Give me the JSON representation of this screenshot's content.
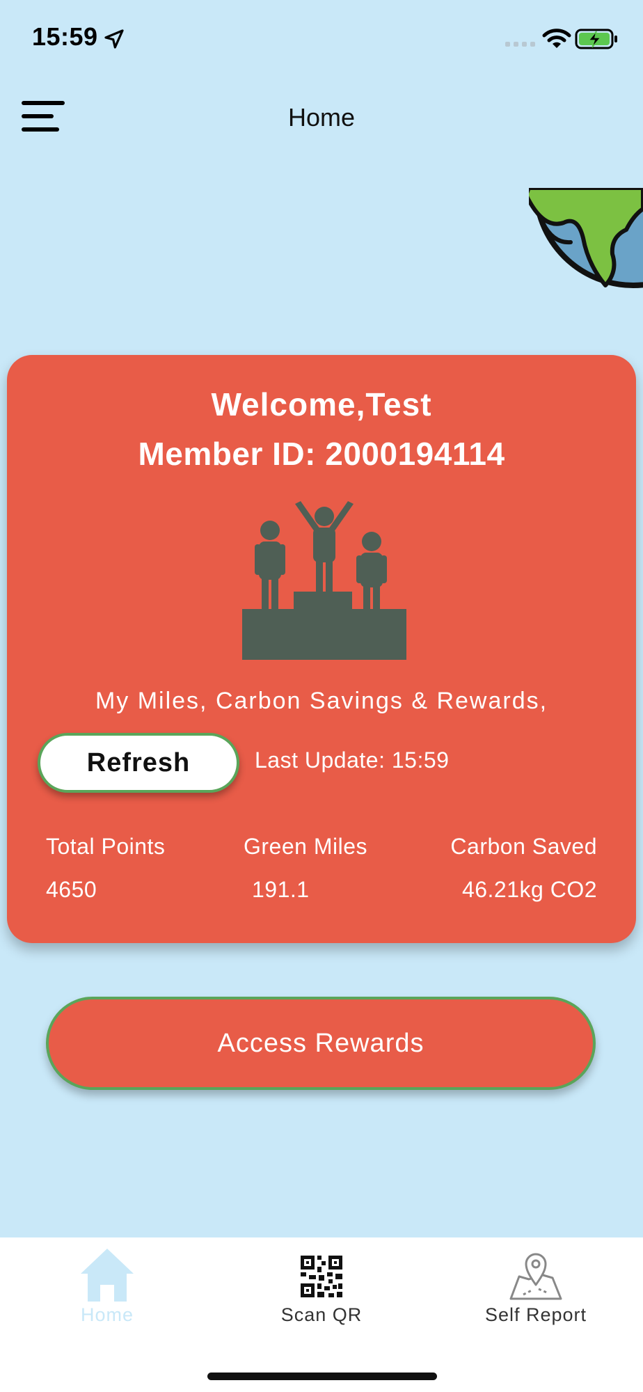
{
  "status_bar": {
    "time": "15:59",
    "icons": [
      "location-arrow-icon",
      "cellular-signal-icon",
      "wifi-icon",
      "battery-charging-icon"
    ]
  },
  "app_bar": {
    "title": "Home",
    "menu_icon": "menu-icon"
  },
  "decoration": {
    "globe_icon": "globe-icon"
  },
  "card": {
    "welcome": "Welcome,Test",
    "member_id": "Member ID: 2000194114",
    "illustration": "podium-icon",
    "subtitle": "My Miles, Carbon Savings & Rewards,",
    "refresh_label": "Refresh",
    "last_update": "Last Update: 15:59",
    "stats": [
      {
        "label": "Total Points",
        "value": "4650"
      },
      {
        "label": "Green Miles",
        "value": "191.1"
      },
      {
        "label": "Carbon Saved",
        "value": "46.21kg CO2"
      }
    ]
  },
  "rewards_button": {
    "label": "Access Rewards"
  },
  "bottom_nav": {
    "items": [
      {
        "label": "Home",
        "icon": "home-icon",
        "active": true
      },
      {
        "label": "Scan QR",
        "icon": "qr-code-icon",
        "active": false
      },
      {
        "label": "Self Report",
        "icon": "map-pin-icon",
        "active": false
      }
    ]
  },
  "colors": {
    "background": "#c9e8f8",
    "card": "#e85c48",
    "border_green": "#5aa55a",
    "icon_dark": "#4f5f55",
    "active_nav": "#c9e8f8"
  }
}
